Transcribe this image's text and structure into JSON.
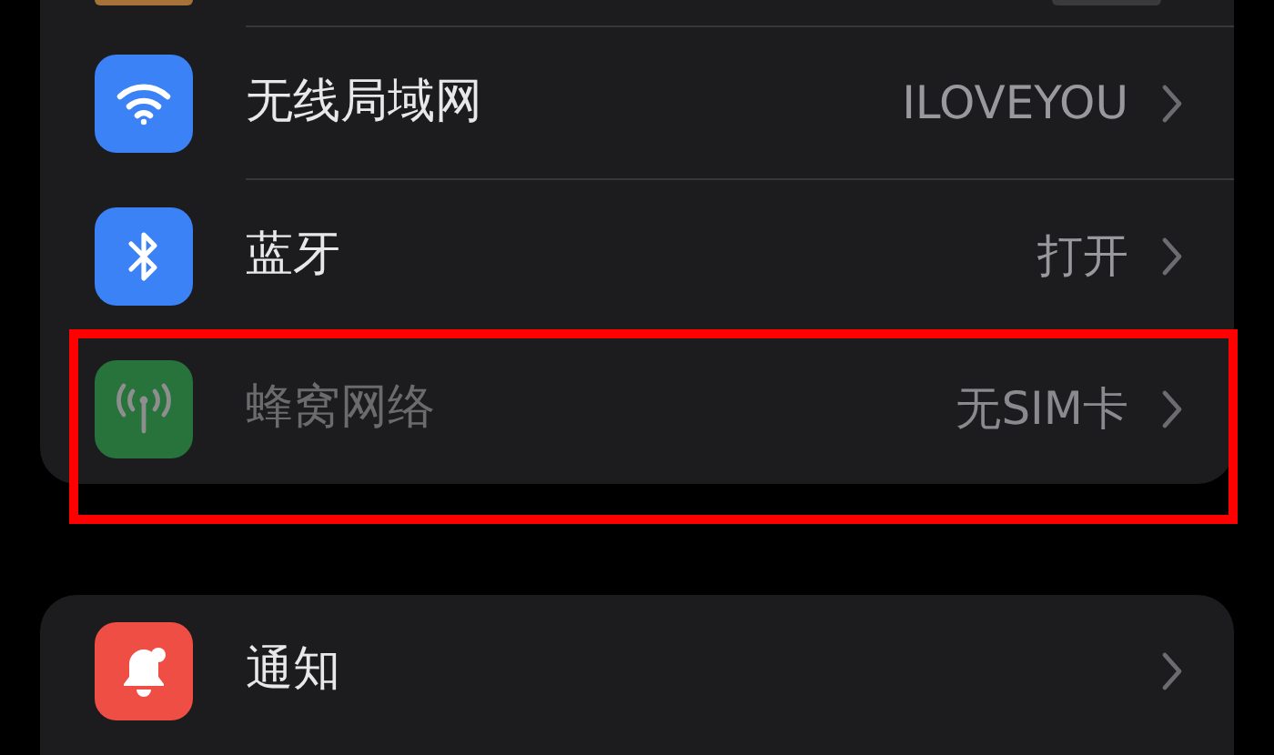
{
  "groups": [
    {
      "rows": [
        {
          "kind": "wifi",
          "label": "无线局域网",
          "value": "ILOVEYOU",
          "disabled": false,
          "highlighted": false
        },
        {
          "kind": "bluetooth",
          "label": "蓝牙",
          "value": "打开",
          "disabled": false,
          "highlighted": false
        },
        {
          "kind": "cellular",
          "label": "蜂窝网络",
          "value": "无SIM卡",
          "disabled": true,
          "highlighted": true
        }
      ]
    },
    {
      "rows": [
        {
          "kind": "notifications",
          "label": "通知",
          "disabled": false,
          "highlighted": false
        }
      ]
    }
  ]
}
